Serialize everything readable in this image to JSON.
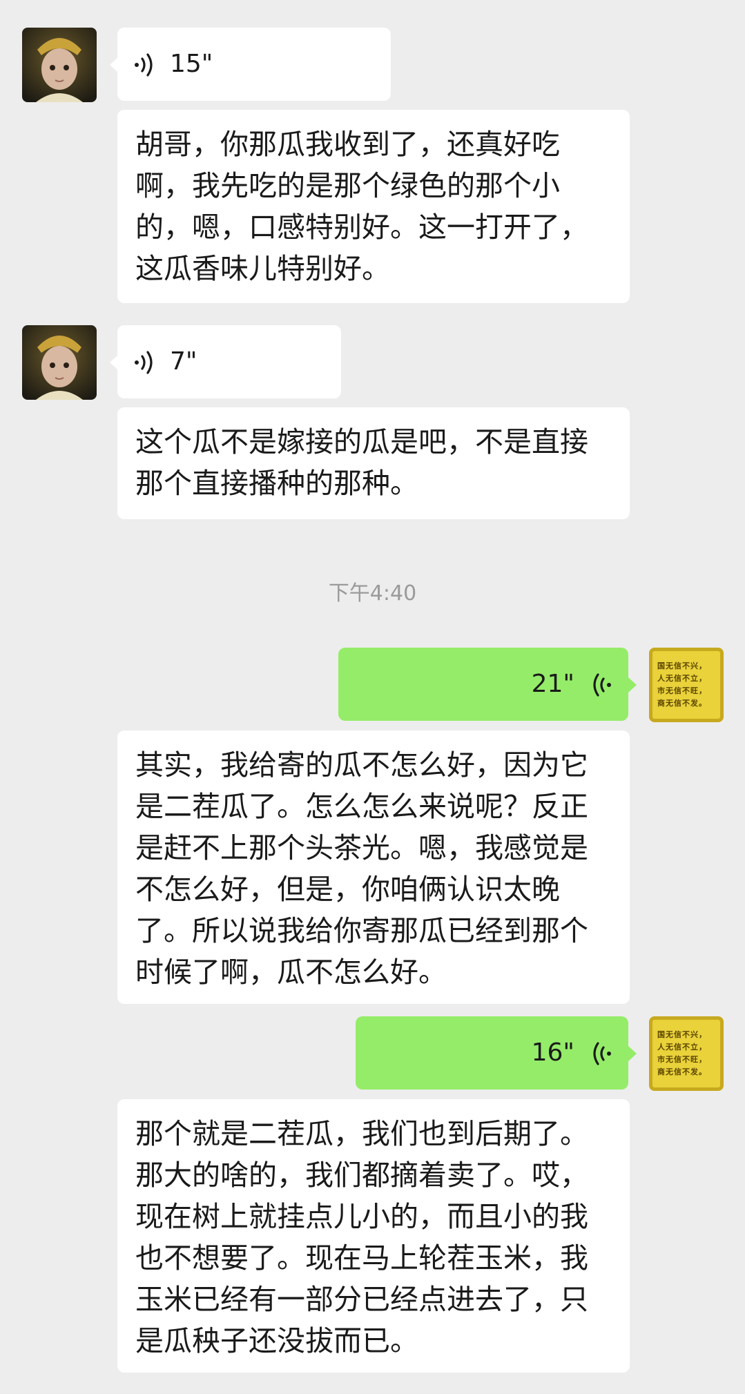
{
  "messages": [
    {
      "voice_duration": "15\"",
      "transcript": "胡哥，你那瓜我收到了，还真好吃啊，我先吃的是那个绿色的那个小的，嗯，口感特别好。这一打开了，这瓜香味儿特别好。"
    },
    {
      "voice_duration": "7\"",
      "transcript": "这个瓜不是嫁接的瓜是吧，不是直接那个直接播种的那种。"
    },
    {
      "voice_duration": "21\"",
      "transcript": "其实，我给寄的瓜不怎么好，因为它是二茬瓜了。怎么怎么来说呢？反正是赶不上那个头茶光。嗯，我感觉是不怎么好，但是，你咱俩认识太晚了。所以说我给你寄那瓜已经到那个时候了啊，瓜不怎么好。"
    },
    {
      "voice_duration": "16\"",
      "transcript": "那个就是二茬瓜，我们也到后期了。那大的啥的，我们都摘着卖了。哎，现在树上就挂点儿小的，而且小的我也不想要了。现在马上轮茬玉米，我玉米已经有一部分已经点进去了，只是瓜秧子还没拔而已。"
    }
  ],
  "timestamp": "下午4:40",
  "self_avatar_text": [
    "国无信不兴，",
    "人无信不立，",
    "市无信不旺，",
    "商无信不发。"
  ],
  "colors": {
    "background": "#ededed",
    "incoming_bubble": "#ffffff",
    "outgoing_bubble": "#95ec69",
    "timestamp": "#9a9a9a"
  },
  "icons": {
    "voice_incoming": "voice-wave-icon",
    "voice_outgoing": "voice-wave-icon",
    "contact_avatar": "avatar-baby",
    "self_avatar": "avatar-notice-board"
  }
}
